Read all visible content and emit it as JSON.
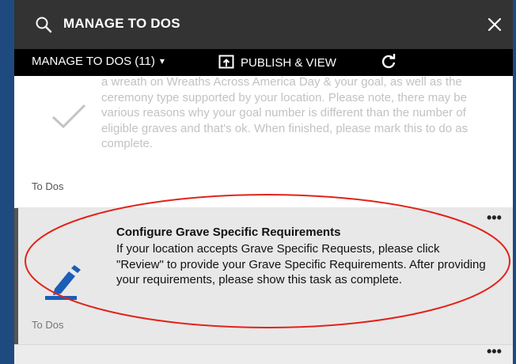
{
  "search": {
    "title": "MANAGE TO DOS",
    "icon": "search-icon",
    "close_icon": "close-icon"
  },
  "toolbar": {
    "manage_label": "MANAGE TO DOS (11)",
    "manage_caret": "▾",
    "publish_label": "PUBLISH & VIEW",
    "refresh_icon": "refresh-icon"
  },
  "cards": [
    {
      "description": "a wreath on Wreaths Across America Day & your goal, as well as the ceremony type supported by your location. Please note, there may be various reasons why your goal number is different than the number of eligible graves and that's ok. When finished, please mark this to do as complete.",
      "label": "To Dos",
      "icon": "checkmark-icon"
    },
    {
      "title": "Configure Grave Specific Requirements",
      "description": "If your location accepts Grave Specific Requests, please click \"Review\" to provide your Grave Specific Requirements. After providing your requirements, please show this task as complete.",
      "label": "To Dos",
      "icon": "pencil-icon",
      "more": "•••"
    },
    {
      "more": "•••"
    }
  ],
  "colors": {
    "page_bg": "#1f4a80",
    "header_bg": "#333333",
    "toolbar_bg": "#000000",
    "accent": "#1a5eb8",
    "highlight_circle": "#e2231a"
  }
}
